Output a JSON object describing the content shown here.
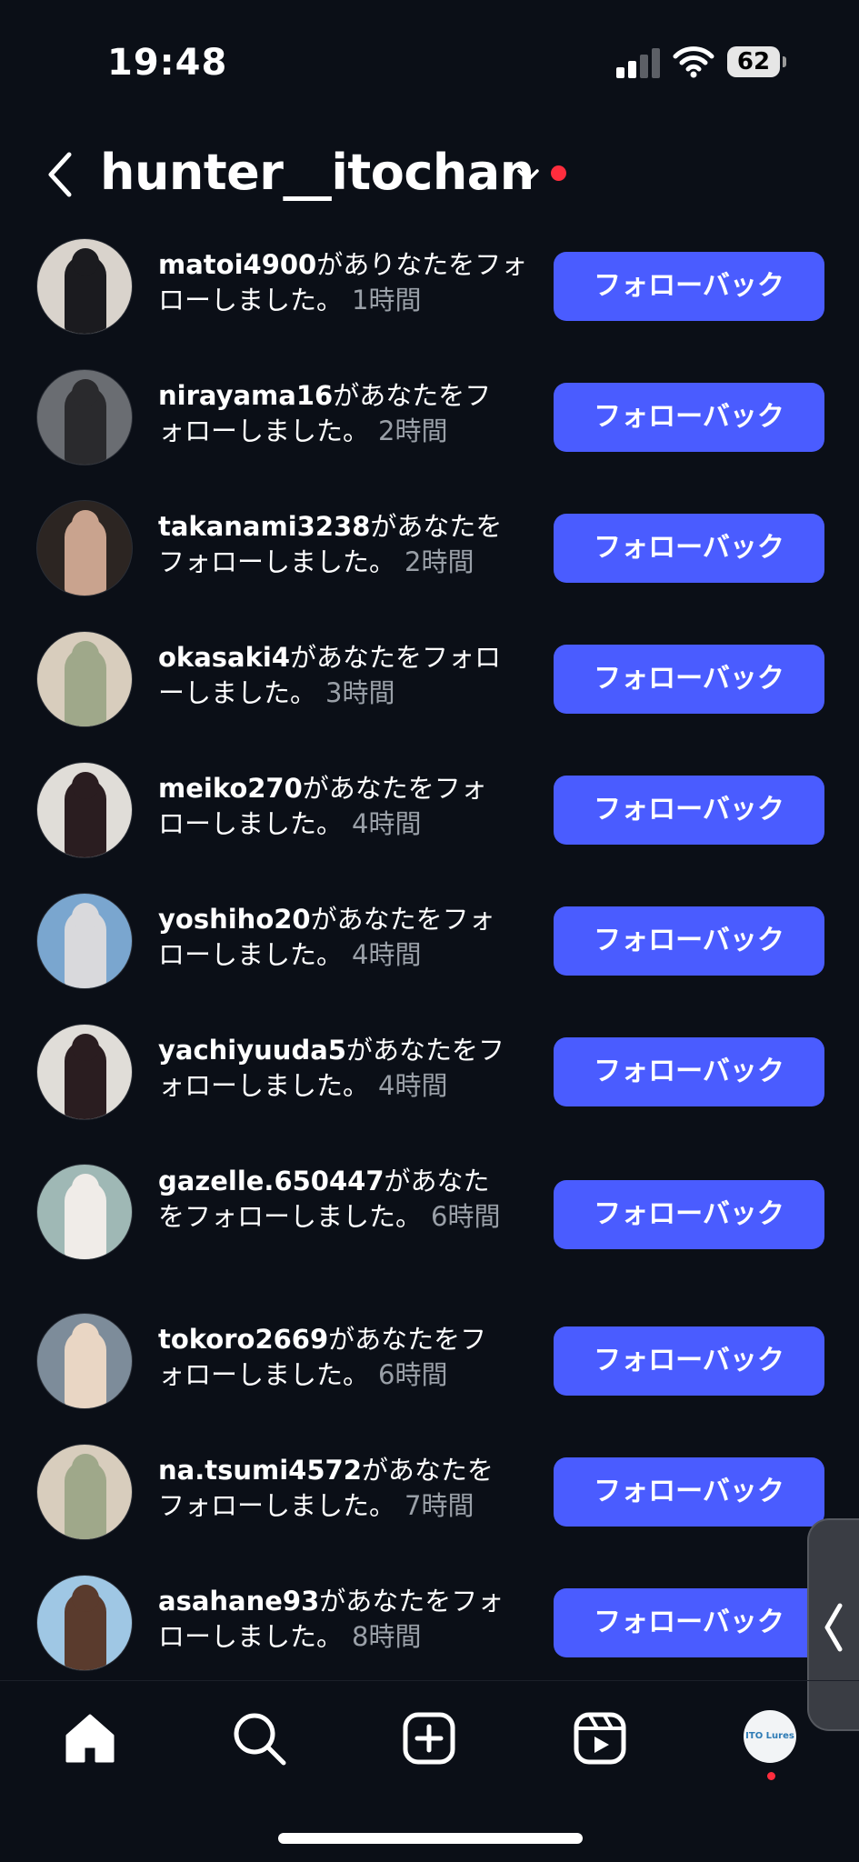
{
  "status_bar": {
    "time": "19:48",
    "battery": "62"
  },
  "header": {
    "account_name": "hunter__itochan"
  },
  "notifications": [
    {
      "username": "matoi4900",
      "lines": [
        "がありなたをフォ",
        "ローしました。"
      ],
      "time": "1時間",
      "button": "フォローバック",
      "avatar_bg": "#d9d3cc",
      "avatar_fig": "#1b1b1f"
    },
    {
      "username": "nirayama16",
      "lines": [
        "があなたをフ",
        "ォローしました。"
      ],
      "time": "2時間",
      "button": "フォローバック",
      "avatar_bg": "#6a6d72",
      "avatar_fig": "#2a2a2d"
    },
    {
      "username": "takanami3238",
      "lines": [
        "があなたを",
        "フォローしました。"
      ],
      "time": "2時間",
      "button": "フォローバック",
      "avatar_bg": "#2c2522",
      "avatar_fig": "#c9a38e"
    },
    {
      "username": "okasaki4",
      "lines": [
        "があなたをフォロ",
        "ーしました。"
      ],
      "time": "3時間",
      "button": "フォローバック",
      "avatar_bg": "#d8cdbd",
      "avatar_fig": "#9fa88a"
    },
    {
      "username": "meiko270",
      "lines": [
        "があなたをフォ",
        "ローしました。"
      ],
      "time": "4時間",
      "button": "フォローバック",
      "avatar_bg": "#e0ddd8",
      "avatar_fig": "#2a1d20"
    },
    {
      "username": "yoshiho20",
      "lines": [
        "があなたをフォ",
        "ローしました。"
      ],
      "time": "4時間",
      "button": "フォローバック",
      "avatar_bg": "#7aa6cf",
      "avatar_fig": "#d9d9dc"
    },
    {
      "username": "yachiyuuda5",
      "lines": [
        "があなたをフ",
        "ォローしました。"
      ],
      "time": "4時間",
      "button": "フォローバック",
      "avatar_bg": "#e0ddd8",
      "avatar_fig": "#2a1d20"
    },
    {
      "username": "gazelle.650447",
      "lines": [
        "があなた",
        "をフォローしました。"
      ],
      "time": "6時間",
      "button": "フォローバック",
      "avatar_bg": "#9fb8b5",
      "avatar_fig": "#f0ece8"
    },
    {
      "username": "tokoro2669",
      "lines": [
        "があなたをフ",
        "ォローしました。"
      ],
      "time": "6時間",
      "button": "フォローバック",
      "avatar_bg": "#7d8c9a",
      "avatar_fig": "#e9d6c4"
    },
    {
      "username": "na.tsumi4572",
      "lines": [
        "があなたを",
        "フォローしました。"
      ],
      "time": "7時間",
      "button": "フォローバック",
      "avatar_bg": "#d8cdbd",
      "avatar_fig": "#9fa88a"
    },
    {
      "username": "asahane93",
      "lines": [
        "があなたをフォ",
        "ローしました。"
      ],
      "time": "8時間",
      "button": "フォローバック",
      "avatar_bg": "#9fc7e4",
      "avatar_fig": "#5a3b2d"
    }
  ],
  "profile": {
    "avatar_text": "ITO Lures"
  },
  "colors": {
    "background": "#0b0f17",
    "button": "#4a5cff",
    "notification_dot": "#ff2d3d",
    "muted_text": "#9aa0a8"
  }
}
